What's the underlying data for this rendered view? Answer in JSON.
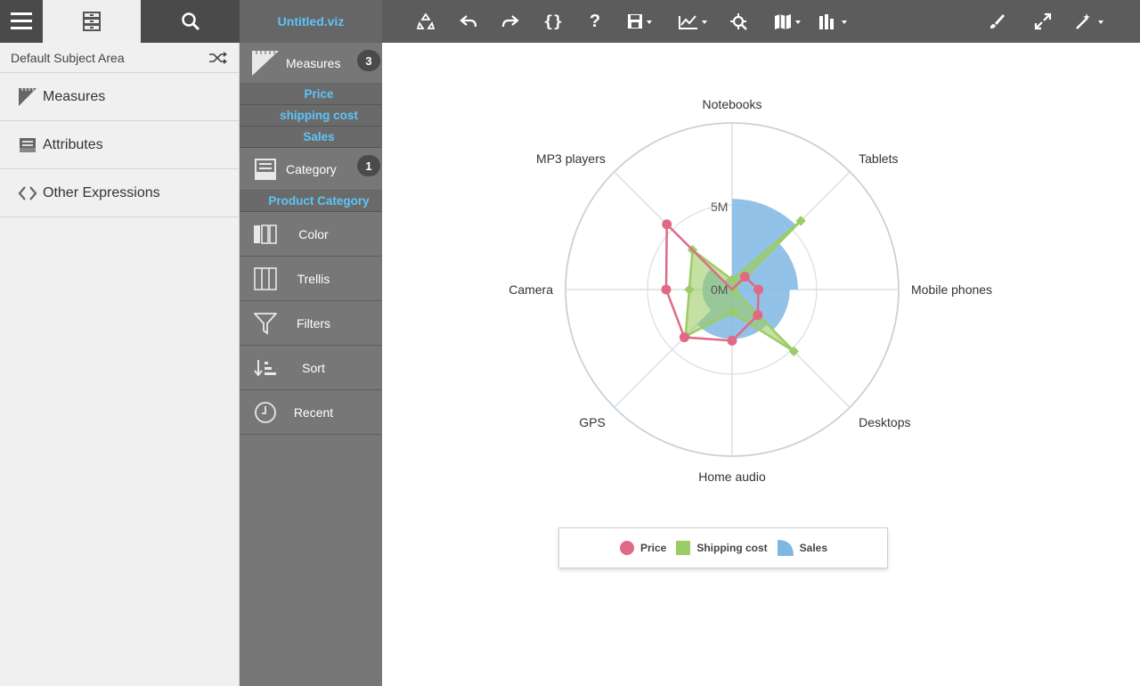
{
  "toolbar": {
    "title": "Untitled.viz",
    "icons": [
      "menu-icon",
      "data-panel-icon",
      "search-icon",
      "recycle-icon",
      "undo-icon",
      "redo-icon",
      "code-braces-icon",
      "help-icon",
      "save-icon",
      "chart-type-icon",
      "explore-icon",
      "map-icon",
      "grid-icon",
      "brush-icon",
      "expand-icon",
      "magic-wand-icon"
    ]
  },
  "left_panel": {
    "subject_area": "Default Subject Area",
    "items": [
      {
        "label": "Measures",
        "icon": "ruler-icon"
      },
      {
        "label": "Attributes",
        "icon": "drawer-icon"
      },
      {
        "label": "Other Expressions",
        "icon": "code-icon"
      }
    ]
  },
  "grammar": {
    "measures": {
      "label": "Measures",
      "count": "3",
      "pills": [
        "Price",
        "shipping cost",
        "Sales"
      ]
    },
    "category": {
      "label": "Category",
      "count": "1",
      "pills": [
        "Product Category"
      ]
    },
    "rows": [
      "Color",
      "Trellis",
      "Filters",
      "Sort",
      "Recent"
    ]
  },
  "colors": {
    "price": "#e06a86",
    "shipping": "#9ccc65",
    "sales": "#7fb7e3",
    "accent": "#5ec4f7"
  },
  "chart_data": {
    "type": "radar",
    "categories": [
      "Notebooks",
      "Tablets",
      "Mobile phones",
      "Desktops",
      "Home audio",
      "GPS",
      "Camera",
      "MP3 players"
    ],
    "radial_ticks": [
      "0M",
      "5M"
    ],
    "series": [
      {
        "name": "Price",
        "kind": "line-points",
        "values": [
          0.0,
          1.1,
          1.6,
          2.2,
          3.1,
          4.1,
          4.0,
          5.6
        ]
      },
      {
        "name": "Shipping cost",
        "kind": "area",
        "values": [
          0.6,
          5.9,
          0.1,
          5.3,
          1.4,
          4.0,
          2.6,
          3.4
        ]
      },
      {
        "name": "Sales",
        "kind": "sectors",
        "values": [
          5.5,
          4.0,
          3.5,
          3.0,
          3.0,
          1.8,
          1.8,
          0.7
        ]
      }
    ],
    "legend": [
      "Price",
      "Shipping cost",
      "Sales"
    ],
    "legend_position": "bottom"
  }
}
